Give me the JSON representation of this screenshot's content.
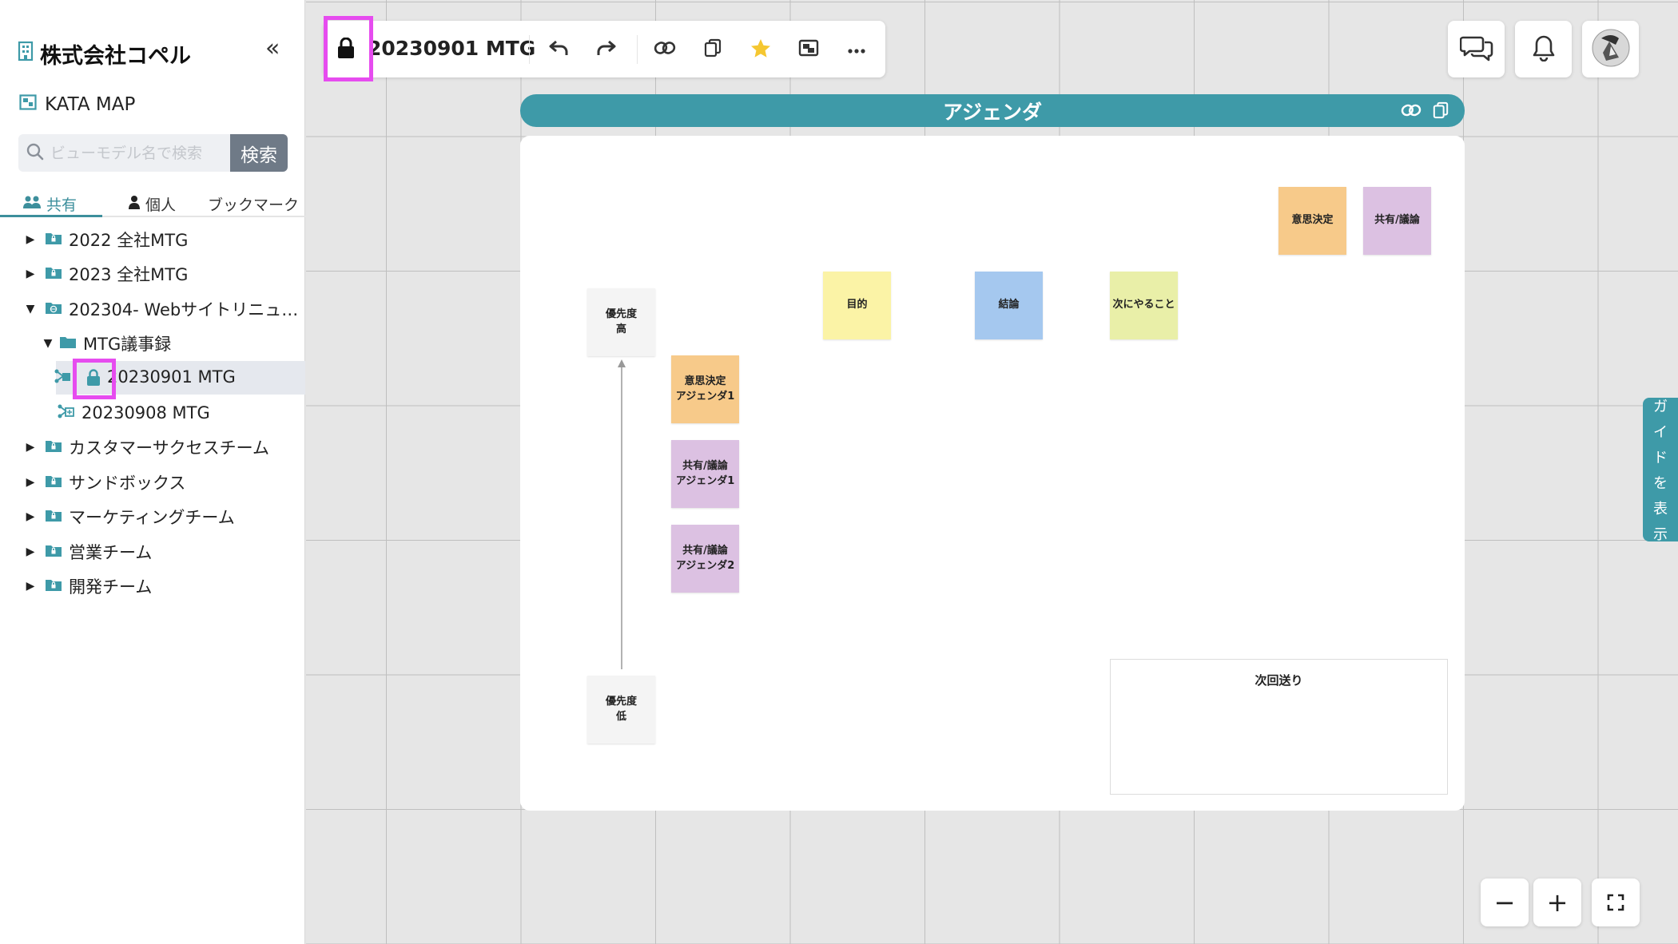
{
  "sidebar": {
    "company_name": "株式会社コペル",
    "app_name": "KATA MAP",
    "search": {
      "placeholder": "ビューモデル名で検索",
      "button_label": "検索"
    },
    "tabs": [
      {
        "label": "共有",
        "icon": "people-icon",
        "active": true
      },
      {
        "label": "個人",
        "icon": "person-icon",
        "active": false
      },
      {
        "label": "ブックマーク",
        "active": false
      }
    ],
    "tree": [
      {
        "label": "2022 全社MTG",
        "type": "folder-lock",
        "expanded": false
      },
      {
        "label": "2023 全社MTG",
        "type": "folder-lock",
        "expanded": false
      },
      {
        "label": "202304- Webサイトリニュ…",
        "type": "folder-globe",
        "expanded": true
      },
      {
        "label": "MTG議事録",
        "type": "folder",
        "expanded": true
      },
      {
        "label": "20230901 MTG",
        "type": "view-lock",
        "selected": true
      },
      {
        "label": "20230908 MTG",
        "type": "view"
      },
      {
        "label": "カスタマーサクセスチーム",
        "type": "folder-lock",
        "expanded": false
      },
      {
        "label": "サンドボックス",
        "type": "folder-lock",
        "expanded": false
      },
      {
        "label": "マーケティングチーム",
        "type": "folder-lock",
        "expanded": false
      },
      {
        "label": "営業チーム",
        "type": "folder-lock",
        "expanded": false
      },
      {
        "label": "開発チーム",
        "type": "folder-lock",
        "expanded": false
      }
    ]
  },
  "toolbar": {
    "title": "20230901 MTG",
    "buttons": [
      "lock-icon",
      "undo-icon",
      "redo-icon",
      "link-icon",
      "copy-icon",
      "star-icon",
      "image-icon",
      "more-icon"
    ]
  },
  "top_right": [
    "chat-icon",
    "bell-icon",
    "avatar"
  ],
  "board": {
    "frame_title": "アジェンダ",
    "stickies": {
      "decision": "意思決定",
      "share_discuss": "共有/議論",
      "purpose": "目的",
      "conclusion": "結論",
      "next_todo": "次にやること",
      "priority_high": "優先度\n高",
      "priority_low": "優先度\n低",
      "agenda_decision_1": "意思決定\nアジェンダ1",
      "agenda_share_1": "共有/議論\nアジェンダ1",
      "agenda_share_2": "共有/議論\nアジェンダ2"
    },
    "next_box_title": "次回送り"
  },
  "guide_tab": [
    "ガ",
    "イ",
    "ド",
    "を",
    "表",
    "示"
  ],
  "zoom": {
    "minus": "−",
    "plus": "+"
  },
  "colors": {
    "accent": "#3e9aa8",
    "highlight": "#e64cef",
    "sticky_orange": "#f7ca8a",
    "sticky_purple": "#dcc1e2",
    "sticky_yellow": "#fbf3a6",
    "sticky_blue": "#a5c8ef",
    "sticky_lime": "#e9efa8",
    "sticky_gray": "#f4f4f4"
  }
}
